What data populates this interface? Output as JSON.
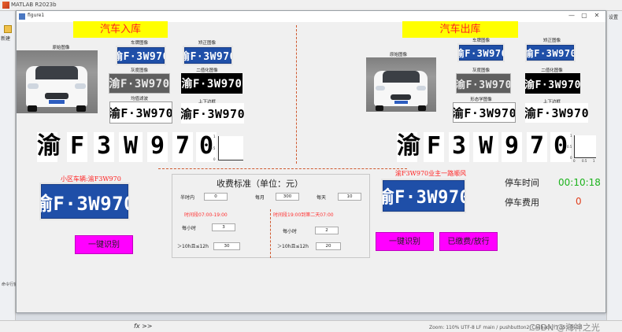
{
  "matlab": {
    "title": "MATLAB R2023b",
    "new_label": "新建",
    "settings_label": "设置",
    "cmd_label": "命令行窗口",
    "fx": "fx >>",
    "status": "Zoom: 110%    UTF-8    LF    main / pushbutton2_Callback    行 351   列 16",
    "watermark": "CSDN @海神之光"
  },
  "figure": {
    "title": "figure1",
    "controls": [
      "—",
      "▢",
      "✕"
    ]
  },
  "entry": {
    "title": "汽车入库",
    "original_caption": "原始图像",
    "captions": [
      "车牌图像",
      "矫正图像",
      "灰度图像",
      "二值化图像",
      "均值滤波",
      "上下边框"
    ],
    "plate_text": "渝F·3W970",
    "segmented": [
      "渝",
      "F",
      "3",
      "W",
      "9",
      "7",
      "0"
    ],
    "recognized": "小区车辆:渝F3W970",
    "button": "一键识别"
  },
  "exit": {
    "title": "汽车出库",
    "original_caption": "原始图像",
    "captions": [
      "车牌图像",
      "矫正图像",
      "灰度图像",
      "二值化图像",
      "形态学图像",
      "上下边框"
    ],
    "plate_text": "渝F·3W970",
    "segmented": [
      "渝",
      "F",
      "3",
      "W",
      "9",
      "7",
      "0"
    ],
    "recognized": "渝F3W970业主一路顺风",
    "buttons": [
      "一键识别",
      "已缴费/放行"
    ],
    "park_time_label": "停车时间",
    "park_time_value": "00:10:18",
    "park_fee_label": "停车费用",
    "park_fee_value": "0"
  },
  "mini_axes": {
    "y_ticks": [
      "1",
      "0.5",
      "0"
    ],
    "x_ticks": [
      "0",
      "0.5",
      "1"
    ]
  },
  "fee": {
    "title": "收费标准（单位：元）",
    "free_label": "半时内",
    "free_value": "0",
    "monthly_label": "每月",
    "monthly_value": "300",
    "daily_label": "每天",
    "daily_value": "10",
    "day_period": "时间段07:00-19:00",
    "night_period": "时间段19:00到第二天07:00",
    "per_hour_label": "每小时",
    "day_per_hour": "3",
    "night_per_hour": "2",
    "over_label": "＞10h且≤12h",
    "day_over": "30",
    "night_over": "20"
  }
}
